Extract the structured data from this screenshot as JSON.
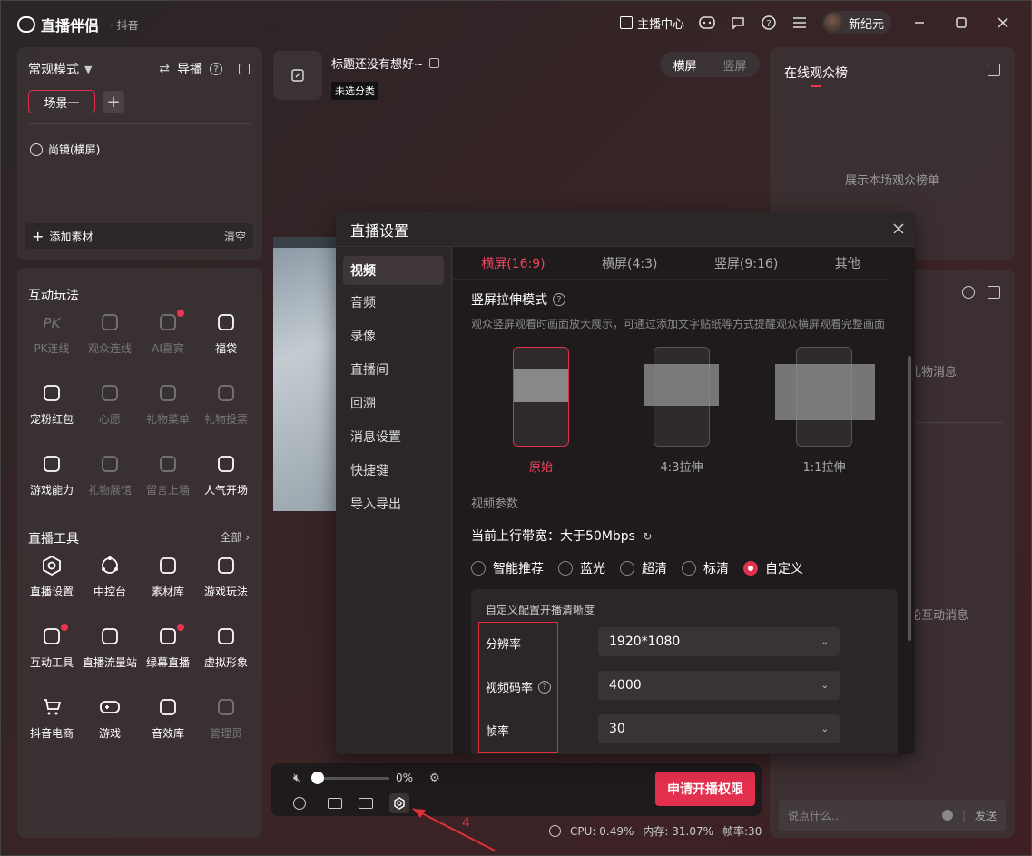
{
  "titlebar": {
    "app_name": "直播伴侣",
    "sub": "· 抖音",
    "host_center": "主播中心",
    "username": "新纪元"
  },
  "left_top": {
    "mode": "常规模式",
    "guide": "导播",
    "scene": "场景一",
    "source": "尚镜(横屏)",
    "add_material": "添加素材",
    "clear": "清空"
  },
  "interactive": {
    "title": "互动玩法",
    "items": [
      {
        "label": "PK连线",
        "icon": "pk-icon",
        "enabled": false
      },
      {
        "label": "观众连线",
        "icon": "audience-link-icon",
        "enabled": false
      },
      {
        "label": "AI嘉宾",
        "icon": "ai-guest-icon",
        "enabled": false,
        "dot": true
      },
      {
        "label": "福袋",
        "icon": "lucky-bag-icon",
        "enabled": true
      },
      {
        "label": "宠粉红包",
        "icon": "red-packet-icon",
        "enabled": true
      },
      {
        "label": "心愿",
        "icon": "wish-icon",
        "enabled": false
      },
      {
        "label": "礼物菜单",
        "icon": "gift-menu-icon",
        "enabled": false
      },
      {
        "label": "礼物投票",
        "icon": "gift-vote-icon",
        "enabled": false
      },
      {
        "label": "游戏能力",
        "icon": "game-ability-icon",
        "enabled": true
      },
      {
        "label": "礼物展馆",
        "icon": "gift-hall-icon",
        "enabled": false
      },
      {
        "label": "留言上墙",
        "icon": "message-wall-icon",
        "enabled": false
      },
      {
        "label": "人气开场",
        "icon": "popularity-open-icon",
        "enabled": true
      }
    ]
  },
  "tools": {
    "title": "直播工具",
    "all": "全部",
    "items": [
      {
        "label": "直播设置",
        "icon": "live-settings-icon",
        "enabled": true
      },
      {
        "label": "中控台",
        "icon": "control-center-icon",
        "enabled": true
      },
      {
        "label": "素材库",
        "icon": "material-library-icon",
        "enabled": true
      },
      {
        "label": "游戏玩法",
        "icon": "game-play-icon",
        "enabled": true
      },
      {
        "label": "互动工具",
        "icon": "interactive-tool-icon",
        "enabled": true,
        "dot": true
      },
      {
        "label": "直播流量站",
        "icon": "traffic-station-icon",
        "enabled": true
      },
      {
        "label": "绿幕直播",
        "icon": "green-screen-icon",
        "enabled": true,
        "dot": true
      },
      {
        "label": "虚拟形象",
        "icon": "avatar-icon",
        "enabled": true
      },
      {
        "label": "抖音电商",
        "icon": "ecommerce-icon",
        "enabled": true
      },
      {
        "label": "游戏",
        "icon": "gamepad-icon",
        "enabled": true
      },
      {
        "label": "音效库",
        "icon": "sound-library-icon",
        "enabled": true
      },
      {
        "label": "管理员",
        "icon": "admin-icon",
        "enabled": false
      }
    ]
  },
  "stream": {
    "title": "标题还没有想好~",
    "category": "未选分类",
    "orient_h": "横屏",
    "orient_v": "竖屏"
  },
  "rank": {
    "title": "在线观众榜",
    "empty": "展示本场观众榜单"
  },
  "messages": {
    "gift_msg": "礼物消息",
    "comment_msg": "论互动消息",
    "input_placeholder": "说点什么...",
    "send": "发送"
  },
  "controls": {
    "volume": "0%",
    "volume_level": 0,
    "apply": "申请开播权限",
    "arrow_label": "4"
  },
  "status": {
    "cpu": "CPU: 0.49%",
    "mem": "内存: 31.07%",
    "fps": "帧率:30"
  },
  "dialog": {
    "title": "直播设置",
    "nav": [
      "视频",
      "音频",
      "录像",
      "直播间",
      "回溯",
      "消息设置",
      "快捷键",
      "导入导出"
    ],
    "tabs": [
      "横屏(16:9)",
      "横屏(4:3)",
      "竖屏(9:16)",
      "其他"
    ],
    "stretch_title": "竖屏拉伸模式",
    "stretch_hint": "观众竖屏观看时画面放大展示，可通过添加文字贴纸等方式提醒观众横屏观看完整画面",
    "stretch_options": [
      "原始",
      "4:3拉伸",
      "1:1拉伸"
    ],
    "params_title": "视频参数",
    "bandwidth": "当前上行带宽：大于50Mbps",
    "quality": [
      "智能推荐",
      "蓝光",
      "超清",
      "标清",
      "自定义"
    ],
    "quality_selected": "自定义",
    "custom_title": "自定义配置开播清晰度",
    "resolution_label": "分辨率",
    "resolution": "1920*1080",
    "bitrate_label": "视频码率",
    "bitrate": "4000",
    "fps_label": "帧率",
    "fps": "30"
  },
  "colors": {
    "accent": "#e2304e",
    "annotation": "#e0303a"
  }
}
